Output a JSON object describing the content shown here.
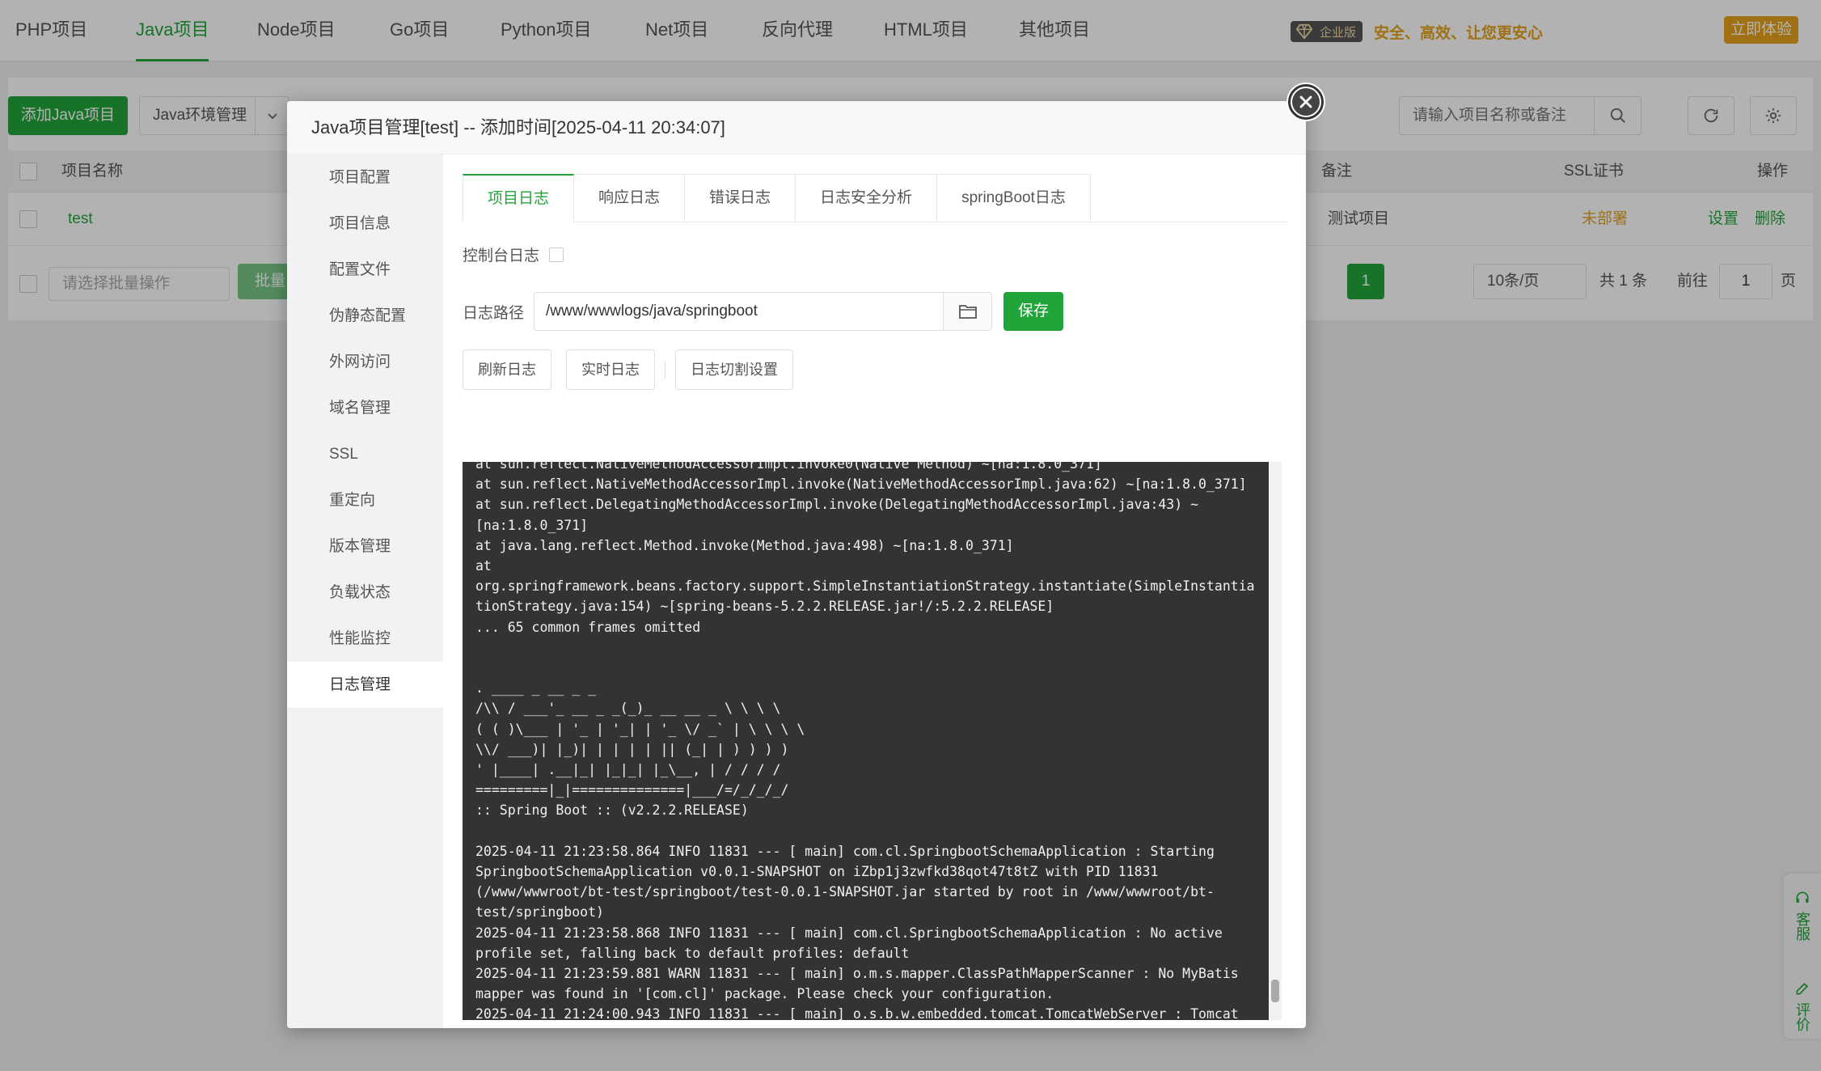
{
  "topnav": {
    "tabs": [
      "PHP项目",
      "Java项目",
      "Node项目",
      "Go项目",
      "Python项目",
      "Net项目",
      "反向代理",
      "HTML项目",
      "其他项目"
    ],
    "active_index": 1,
    "enterprise_badge": "企业版",
    "slogan": "安全、高效、让您更安心",
    "trial_button": "立即体验"
  },
  "toolbar": {
    "add_project": "添加Java项目",
    "env_manage": "Java环境管理",
    "search_placeholder": "请输入项目名称或备注"
  },
  "table": {
    "headers": {
      "name": "项目名称",
      "remark": "备注",
      "ssl": "SSL证书",
      "actions": "操作"
    },
    "rows": [
      {
        "name": "test",
        "remark": "测试项目",
        "ssl": "未部署",
        "settings": "设置",
        "delete": "删除"
      }
    ]
  },
  "bottom": {
    "batch_placeholder": "请选择批量操作",
    "batch_button": "批量",
    "current_page": "1",
    "per_page": "10条/页",
    "total_text": "共 1 条",
    "goto_label": "前往",
    "goto_value": "1",
    "page_suffix": "页"
  },
  "modal": {
    "title": "Java项目管理[test] -- 添加时间[2025-04-11 20:34:07]",
    "menu": [
      "项目配置",
      "项目信息",
      "配置文件",
      "伪静态配置",
      "外网访问",
      "域名管理",
      "SSL",
      "重定向",
      "版本管理",
      "负载状态",
      "性能监控",
      "日志管理"
    ],
    "menu_active_index": 11,
    "tabs": [
      "项目日志",
      "响应日志",
      "错误日志",
      "日志安全分析",
      "springBoot日志"
    ],
    "tab_active_index": 0,
    "console_log_label": "控制台日志",
    "log_path_label": "日志路径",
    "log_path_value": "/www/wwwlogs/java/springboot",
    "save_button": "保存",
    "refresh_button": "刷新日志",
    "realtime_button": "实时日志",
    "rotate_button": "日志切割设置",
    "log_text": "at sun.reflect.NativeMethodAccessorImpl.invoke0(Native Method) ~[na:1.8.0_371]\nat sun.reflect.NativeMethodAccessorImpl.invoke(NativeMethodAccessorImpl.java:62) ~[na:1.8.0_371]\nat sun.reflect.DelegatingMethodAccessorImpl.invoke(DelegatingMethodAccessorImpl.java:43) ~\n[na:1.8.0_371]\nat java.lang.reflect.Method.invoke(Method.java:498) ~[na:1.8.0_371]\nat\norg.springframework.beans.factory.support.SimpleInstantiationStrategy.instantiate(SimpleInstantia\ntionStrategy.java:154) ~[spring-beans-5.2.2.RELEASE.jar!/:5.2.2.RELEASE]\n... 65 common frames omitted\n\n\n. ____ _ __ _ _\n/\\\\ / ___'_ __ _ _(_)_ __ __ _ \\ \\ \\ \\\n( ( )\\___ | '_ | '_| | '_ \\/ _` | \\ \\ \\ \\\n\\\\/ ___)| |_)| | | | | || (_| | ) ) ) )\n' |____| .__|_| |_|_| |_\\__, | / / / /\n=========|_|==============|___/=/_/_/_/\n:: Spring Boot :: (v2.2.2.RELEASE)\n\n2025-04-11 21:23:58.864 INFO 11831 --- [ main] com.cl.SpringbootSchemaApplication : Starting\nSpringbootSchemaApplication v0.0.1-SNAPSHOT on iZbp1j3zwfkd38qot47t8tZ with PID 11831\n(/www/wwwroot/bt-test/springboot/test-0.0.1-SNAPSHOT.jar started by root in /www/wwwroot/bt-\ntest/springboot)\n2025-04-11 21:23:58.868 INFO 11831 --- [ main] com.cl.SpringbootSchemaApplication : No active\nprofile set, falling back to default profiles: default\n2025-04-11 21:23:59.881 WARN 11831 --- [ main] o.m.s.mapper.ClassPathMapperScanner : No MyBatis\nmapper was found in '[com.cl]' package. Please check your configuration.\n2025-04-11 21:24:00.943 INFO 11831 --- [ main] o.s.b.w.embedded.tomcat.TomcatWebServer : Tomcat"
  },
  "float": {
    "service": "客服",
    "review": "评价"
  },
  "colors": {
    "brand_green": "#20a53a",
    "gold": "#e5a21e",
    "log_bg": "#333333"
  }
}
